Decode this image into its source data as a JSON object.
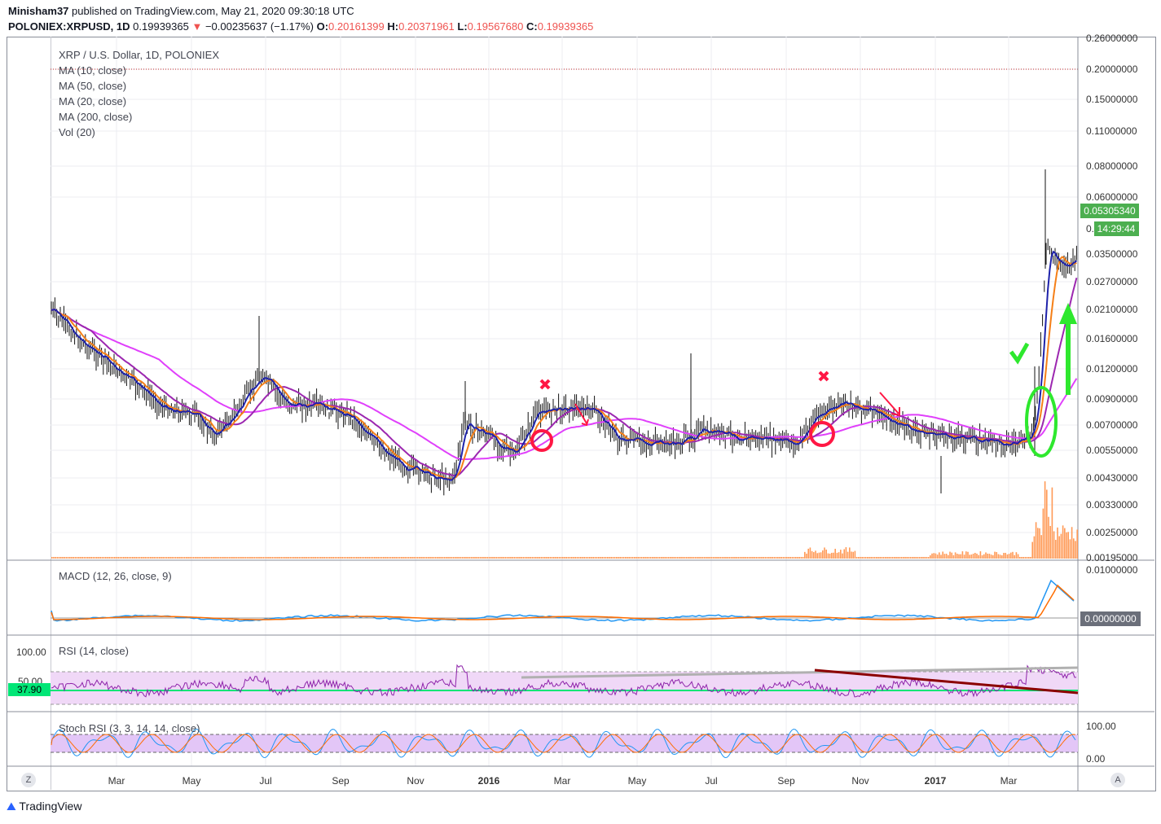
{
  "header": {
    "author": "Minisham37",
    "published": "published on TradingView.com, May 21, 2020 09:30:18 UTC",
    "symbol": "POLONIEX:XRPUSD, 1D",
    "last": "0.19939365",
    "change": "−0.00235637 (−1.17%)",
    "o_label": "O:",
    "o": "0.20161399",
    "h_label": "H:",
    "h": "0.20371961",
    "l_label": "L:",
    "l": "0.19567680",
    "c_label": "C:",
    "c": "0.19939365"
  },
  "main_pane": {
    "title": "XRP / U.S. Dollar, 1D, POLONIEX",
    "indicators": [
      "MA (10, close)",
      "MA (50, close)",
      "MA (20, close)",
      "MA (200, close)",
      "Vol (20)"
    ],
    "price_axis": [
      "0.20000000",
      "0.15000000",
      "0.11000000",
      "0.08000000",
      "0.06000000",
      "0.03500000",
      "0.02700000",
      "0.02100000",
      "0.01600000",
      "0.01200000",
      "0.00900000",
      "0.00700000",
      "0.00550000",
      "0.00430000",
      "0.00330000",
      "0.00250000",
      "0.00195000"
    ],
    "top_partial_label": "0.26000000",
    "price_tag": "0.05305340",
    "countdown_tag": "14:29:44",
    "countdown_prefix": "0."
  },
  "macd_pane": {
    "title": "MACD (12, 26, close, 9)",
    "axis": [
      "0.01000000"
    ],
    "tag": "0.00000000"
  },
  "rsi_pane": {
    "title": "RSI (14, close)",
    "axis": [
      "100.00",
      "50.00"
    ],
    "tag": "37.90"
  },
  "stoch_pane": {
    "title": "Stoch RSI (3, 3, 14, 14, close)",
    "axis": [
      "100.00",
      "0.00"
    ]
  },
  "time_axis": [
    "Mar",
    "May",
    "Jul",
    "Sep",
    "Nov",
    "2016",
    "Mar",
    "May",
    "Jul",
    "Sep",
    "Nov",
    "2017",
    "Mar"
  ],
  "buttons": {
    "left": "Z",
    "right": "A"
  },
  "footer": {
    "brand": "TradingView"
  },
  "colors": {
    "ma10": "#1e22aa",
    "ma50": "#9c27b0",
    "ma20": "#f57f17",
    "ma200": "#e040fb",
    "volume": "#ff9a56",
    "price_tag": "#4caf50",
    "rsi_tag": "#00e676",
    "annot_red": "#ff1744",
    "annot_green": "#2ee82e"
  },
  "chart_data": {
    "type": "candlestick",
    "title": "XRP / U.S. Dollar, 1D, POLONIEX",
    "x_range": [
      "2015-01",
      "2017-04"
    ],
    "y_scale": "log",
    "ylim": [
      0.00195,
      0.26
    ],
    "series": [
      {
        "name": "MA (10, close)",
        "x": [
          "2015-01",
          "2015-03",
          "2015-05",
          "2015-07",
          "2015-09",
          "2015-11",
          "2016-01",
          "2016-03",
          "2016-05",
          "2016-07",
          "2016-09",
          "2016-11",
          "2017-01",
          "2017-03",
          "2017-04"
        ],
        "values": [
          0.0175,
          0.0105,
          0.0078,
          0.0115,
          0.0078,
          0.0044,
          0.0061,
          0.0082,
          0.0065,
          0.0061,
          0.0061,
          0.008,
          0.0063,
          0.006,
          0.033
        ]
      }
    ]
  }
}
